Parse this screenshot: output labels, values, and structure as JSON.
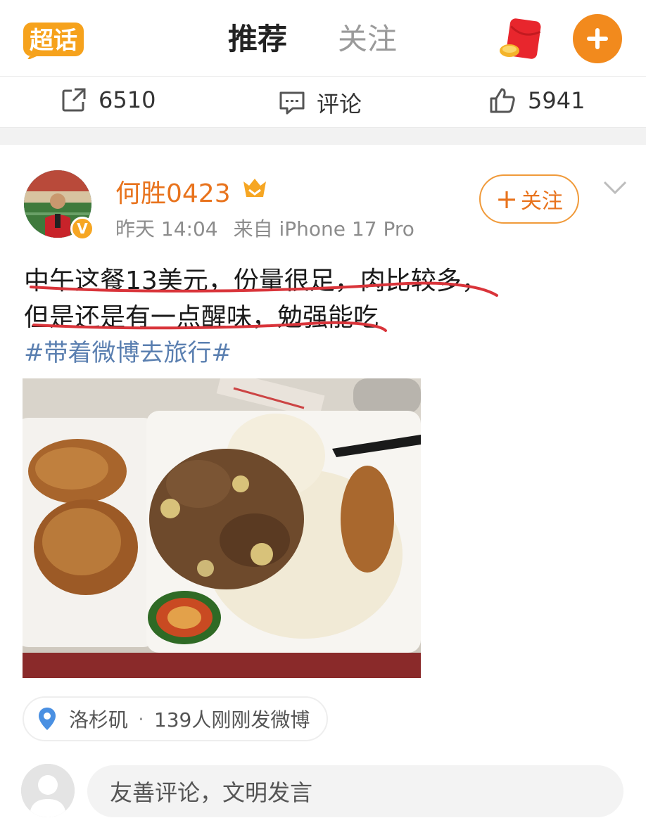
{
  "header": {
    "logo_text": "超话",
    "tabs": [
      {
        "label": "推荐",
        "active": true
      },
      {
        "label": "关注",
        "active": false
      }
    ],
    "accent_color": "#f28a1d"
  },
  "stats": {
    "reposts": "6510",
    "comments_label": "评论",
    "likes": "5941"
  },
  "post": {
    "author": "何胜0423",
    "time": "昨天 14:04",
    "source": "来自 iPhone 17 Pro",
    "verified_badge": "V",
    "follow_label": "关注",
    "text_line1": "中午这餐13美元，份量很足，肉比较多，",
    "text_line2": "但是还是有一点醒味，勉强能吃",
    "hashtag": "#带着微博去旅行#",
    "location": "洛杉矶",
    "location_activity": "139人刚刚发微博"
  },
  "comment_box": {
    "placeholder": "友善评论，文明发言"
  }
}
